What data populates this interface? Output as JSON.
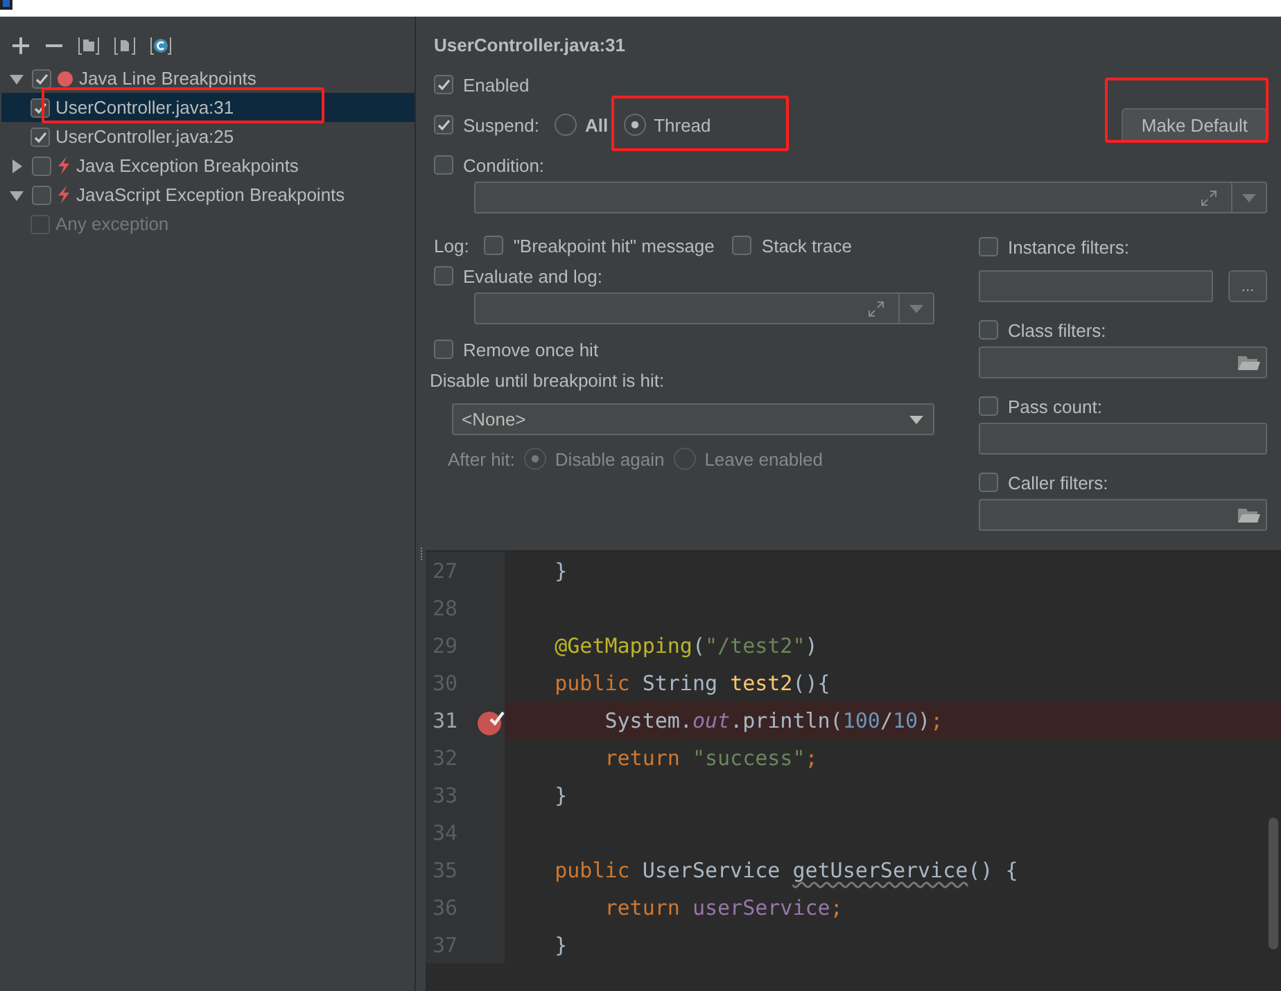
{
  "tree": [
    {
      "kind": "line",
      "label": "Java Line Breakpoints",
      "checked": true,
      "expanded": true,
      "selected": false,
      "annotated": false,
      "children": [
        {
          "label": "UserController.java:31",
          "checked": true,
          "selected": true,
          "disabled": false,
          "annotated": true
        },
        {
          "label": "UserController.java:25",
          "checked": true,
          "selected": false,
          "disabled": false,
          "annotated": false
        }
      ]
    },
    {
      "kind": "exception",
      "label": "Java Exception Breakpoints",
      "checked": false,
      "expanded": false,
      "selected": false,
      "annotated": false
    },
    {
      "kind": "exception",
      "label": "JavaScript Exception Breakpoints",
      "checked": false,
      "expanded": true,
      "selected": false,
      "annotated": false,
      "children": [
        {
          "label": "Any exception",
          "checked": false,
          "selected": false,
          "disabled": true,
          "annotated": false
        }
      ]
    }
  ],
  "details": {
    "title": "UserController.java:31",
    "enabled": {
      "label": "Enabled",
      "checked": true
    },
    "suspend": {
      "label": "Suspend:",
      "checked": true,
      "options": [
        {
          "label": "All",
          "selected": false,
          "default": true,
          "annotated": false
        },
        {
          "label": "Thread",
          "selected": true,
          "default": false,
          "annotated": true
        }
      ]
    },
    "make_default_button": {
      "label": "Make Default",
      "annotated": true
    },
    "condition": {
      "label": "Condition:",
      "checked": false
    },
    "log": {
      "label": "Log:",
      "options": [
        {
          "label": "\"Breakpoint hit\" message",
          "checked": false
        },
        {
          "label": "Stack trace",
          "checked": false
        }
      ]
    },
    "evaluate": {
      "label": "Evaluate and log:",
      "checked": false
    },
    "remove_once_hit": {
      "label": "Remove once hit",
      "checked": false
    },
    "disable_until": {
      "label": "Disable until breakpoint is hit:",
      "value": "<None>"
    },
    "after_hit": {
      "label": "After hit:",
      "disabled": true,
      "options": [
        {
          "label": "Disable again",
          "selected": true
        },
        {
          "label": "Leave enabled",
          "selected": false
        }
      ]
    },
    "filters": [
      {
        "kind": "more",
        "label": "Instance filters:",
        "checked": false,
        "button": "..."
      },
      {
        "kind": "browse",
        "label": "Class filters:",
        "checked": false
      },
      {
        "kind": "plain",
        "label": "Pass count:",
        "checked": false
      },
      {
        "kind": "browse",
        "label": "Caller filters:",
        "checked": false
      }
    ]
  },
  "editor": {
    "lines": [
      {
        "number": "27",
        "breakpoint": false,
        "tokens": [
          {
            "kind": "plain",
            "text": "    }"
          }
        ]
      },
      {
        "number": "28",
        "breakpoint": false
      },
      {
        "number": "29",
        "breakpoint": false,
        "tokens": [
          {
            "kind": "annotation",
            "text": "    @GetMapping"
          },
          {
            "kind": "plain",
            "text": "("
          },
          {
            "kind": "string",
            "text": "\"/test2\""
          },
          {
            "kind": "plain",
            "text": ")"
          }
        ]
      },
      {
        "number": "30",
        "breakpoint": false,
        "tokens": [
          {
            "kind": "keyword",
            "text": "    public"
          },
          {
            "kind": "plain",
            "text": " String "
          },
          {
            "kind": "method",
            "text": "test2"
          },
          {
            "kind": "plain",
            "text": "(){"
          }
        ]
      },
      {
        "number": "31",
        "breakpoint": true,
        "tokens": [
          {
            "kind": "plain",
            "text": "        System."
          },
          {
            "kind": "static",
            "text": "out"
          },
          {
            "kind": "plain",
            "text": ".println("
          },
          {
            "kind": "number",
            "text": "100"
          },
          {
            "kind": "plain",
            "text": "/"
          },
          {
            "kind": "number",
            "text": "10"
          },
          {
            "kind": "plain",
            "text": ")"
          },
          {
            "kind": "keyword",
            "text": ";"
          }
        ]
      },
      {
        "number": "32",
        "breakpoint": false,
        "tokens": [
          {
            "kind": "keyword",
            "text": "        return "
          },
          {
            "kind": "string",
            "text": "\"success\""
          },
          {
            "kind": "keyword",
            "text": ";"
          }
        ]
      },
      {
        "number": "33",
        "breakpoint": false,
        "tokens": [
          {
            "kind": "plain",
            "text": "    }"
          }
        ]
      },
      {
        "number": "34",
        "breakpoint": false
      },
      {
        "number": "35",
        "breakpoint": false,
        "tokens": [
          {
            "kind": "keyword",
            "text": "    public"
          },
          {
            "kind": "plain",
            "text": " UserService "
          },
          {
            "kind": "unused",
            "text": "getUserService"
          },
          {
            "kind": "plain",
            "text": "() {"
          }
        ]
      },
      {
        "number": "36",
        "breakpoint": false,
        "tokens": [
          {
            "kind": "keyword",
            "text": "        return "
          },
          {
            "kind": "field",
            "text": "userService"
          },
          {
            "kind": "keyword",
            "text": ";"
          }
        ]
      },
      {
        "number": "37",
        "breakpoint": false,
        "tokens": [
          {
            "kind": "plain",
            "text": "    }"
          }
        ]
      }
    ]
  }
}
